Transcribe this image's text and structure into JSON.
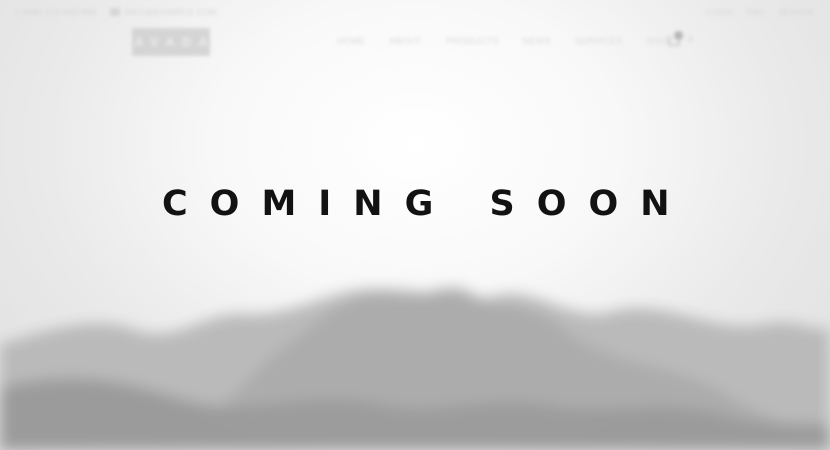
{
  "topbar": {
    "phone": "1 (888) 123-4567890",
    "email": "info@example.com",
    "links": [
      "LOGIN",
      "FAQ",
      "SEARCH"
    ]
  },
  "header": {
    "logo_text": "AVADA",
    "nav": [
      "HOME",
      "ABOUT",
      "PRODUCTS",
      "NEWS",
      "SERVICES",
      "SHOP"
    ],
    "cart_count": "0"
  },
  "hero": {
    "title": "COMING SOON"
  },
  "colors": {
    "title": "#121212",
    "background": "#ededed",
    "mountain": "#a9a9a9"
  }
}
